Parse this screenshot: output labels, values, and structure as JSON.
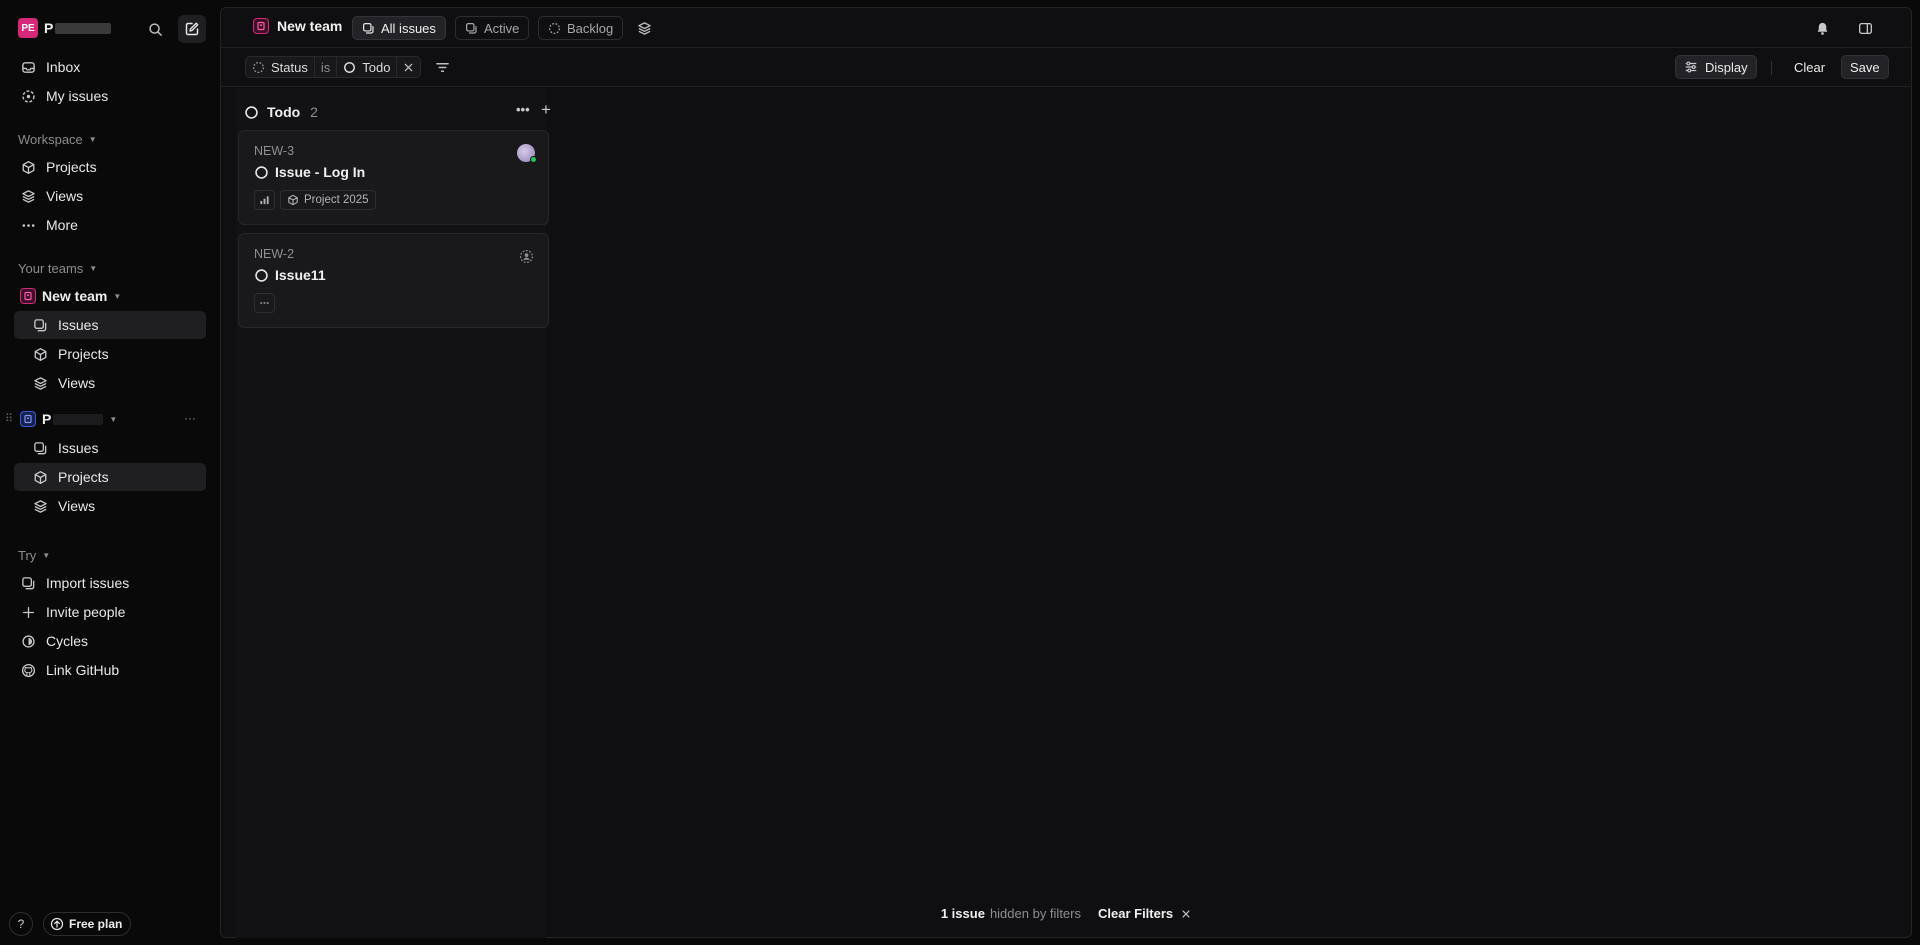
{
  "sidebar": {
    "workspace_initials": "PE",
    "workspace_name": "P",
    "nav": [
      {
        "label": "Inbox",
        "icon": "inbox-icon"
      },
      {
        "label": "My issues",
        "icon": "my-issues-icon"
      }
    ],
    "workspace_section": "Workspace",
    "workspace_items": [
      {
        "label": "Projects",
        "icon": "cube-icon"
      },
      {
        "label": "Views",
        "icon": "layers-icon"
      },
      {
        "label": "More",
        "icon": "ellipsis-icon"
      }
    ],
    "teams_section": "Your teams",
    "team1": {
      "name": "New team",
      "items": [
        {
          "label": "Issues",
          "active": true
        },
        {
          "label": "Projects",
          "active": false
        },
        {
          "label": "Views",
          "active": false
        }
      ]
    },
    "team2": {
      "name": "P",
      "items": [
        {
          "label": "Issues",
          "active": false
        },
        {
          "label": "Projects",
          "active": true
        },
        {
          "label": "Views",
          "active": false
        }
      ]
    },
    "try_section": "Try",
    "try_items": [
      {
        "label": "Import issues",
        "icon": "import-icon"
      },
      {
        "label": "Invite people",
        "icon": "plus-icon"
      },
      {
        "label": "Cycles",
        "icon": "cycle-icon"
      },
      {
        "label": "Link GitHub",
        "icon": "github-icon"
      }
    ],
    "help_label": "?",
    "plan_label": "Free plan"
  },
  "header": {
    "team_name": "New team",
    "tabs": [
      {
        "label": "All issues",
        "active": true
      },
      {
        "label": "Active",
        "active": false
      },
      {
        "label": "Backlog",
        "active": false
      }
    ]
  },
  "filter": {
    "field": "Status",
    "operator": "is",
    "value": "Todo",
    "display_label": "Display",
    "clear_label": "Clear",
    "save_label": "Save"
  },
  "board": {
    "column": {
      "name": "Todo",
      "count": "2"
    },
    "cards": [
      {
        "id": "NEW-3",
        "title": "Issue - Log In",
        "project": "Project 2025"
      },
      {
        "id": "NEW-2",
        "title": "Issue11"
      }
    ]
  },
  "footer": {
    "count_text": "1 issue",
    "hidden_text": "hidden by filters",
    "clear_filters": "Clear Filters"
  },
  "colors": {
    "accent": "#d6287a",
    "team2": "#3a5bd9",
    "background": "#090909",
    "panel": "#0f0f11"
  }
}
